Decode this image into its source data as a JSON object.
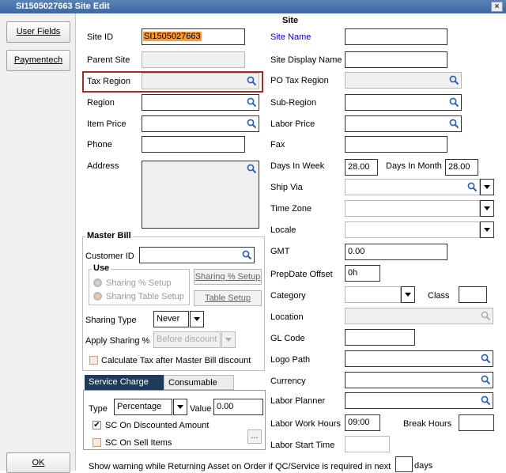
{
  "window": {
    "title": "SI1505027663 Site Edit",
    "close_glyph": "×"
  },
  "sidebar": {
    "user_fields": "User Fields",
    "paymentech": "Paymentech",
    "ok": "OK"
  },
  "section_title": "Site",
  "left": {
    "site_id_label": "Site ID",
    "site_id_value": "SI1505027663",
    "parent_site_label": "Parent Site",
    "tax_region_label": "Tax Region",
    "region_label": "Region",
    "item_price_label": "Item Price",
    "phone_label": "Phone",
    "address_label": "Address"
  },
  "right": {
    "site_name_label": "Site Name",
    "site_display_name_label": "Site Display Name",
    "po_tax_region_label": "PO Tax Region",
    "sub_region_label": "Sub-Region",
    "labor_price_label": "Labor Price",
    "fax_label": "Fax",
    "days_in_week_label": "Days In Week",
    "days_in_week_value": "28.00",
    "days_in_month_label": "Days In Month",
    "days_in_month_value": "28.00",
    "ship_via_label": "Ship Via",
    "time_zone_label": "Time Zone",
    "locale_label": "Locale",
    "gmt_label": "GMT",
    "gmt_value": "0.00",
    "prepdate_offset_label": "PrepDate Offset",
    "prepdate_offset_value": "0h",
    "category_label": "Category",
    "class_label": "Class",
    "location_label": "Location",
    "gl_code_label": "GL Code",
    "logo_path_label": "Logo Path",
    "currency_label": "Currency",
    "labor_planner_label": "Labor Planner",
    "labor_work_hours_label": "Labor Work Hours",
    "labor_work_hours_value": "09:00",
    "break_hours_label": "Break Hours",
    "labor_start_time_label": "Labor Start Time"
  },
  "master_bill": {
    "group_label": "Master Bill",
    "customer_id_label": "Customer ID",
    "use_label": "Use",
    "sharing_pct_radio": "Sharing % Setup",
    "sharing_table_radio": "Sharing Table Setup",
    "sharing_pct_button": "Sharing % Setup",
    "table_setup_button": "Table Setup",
    "sharing_type_label": "Sharing Type",
    "sharing_type_value": "Never",
    "apply_sharing_label": "Apply Sharing %",
    "apply_sharing_value": "Before discount",
    "calc_tax_label": "Calculate Tax after Master Bill discount"
  },
  "tabs": {
    "service_charge": "Service Charge",
    "consumable": "Consumable"
  },
  "service": {
    "type_label": "Type",
    "type_value": "Percentage",
    "value_label": "Value",
    "value_value": "0.00",
    "sc_discounted_label": "SC On Discounted Amount",
    "sc_discounted_check": "✔",
    "sc_sell_label": "SC On Sell Items",
    "ellipsis": "..."
  },
  "footer": {
    "warning_text": "Show warning while Returning Asset on Order if QC/Service is required in next",
    "days_label": "days"
  },
  "colors": {
    "title_bar": "#3b67a4",
    "site_id_highlight": "#ff9933",
    "site_name_label": "#0000cc",
    "tax_region_border": "#a52a2a",
    "active_tab": "#1f3b5c"
  }
}
